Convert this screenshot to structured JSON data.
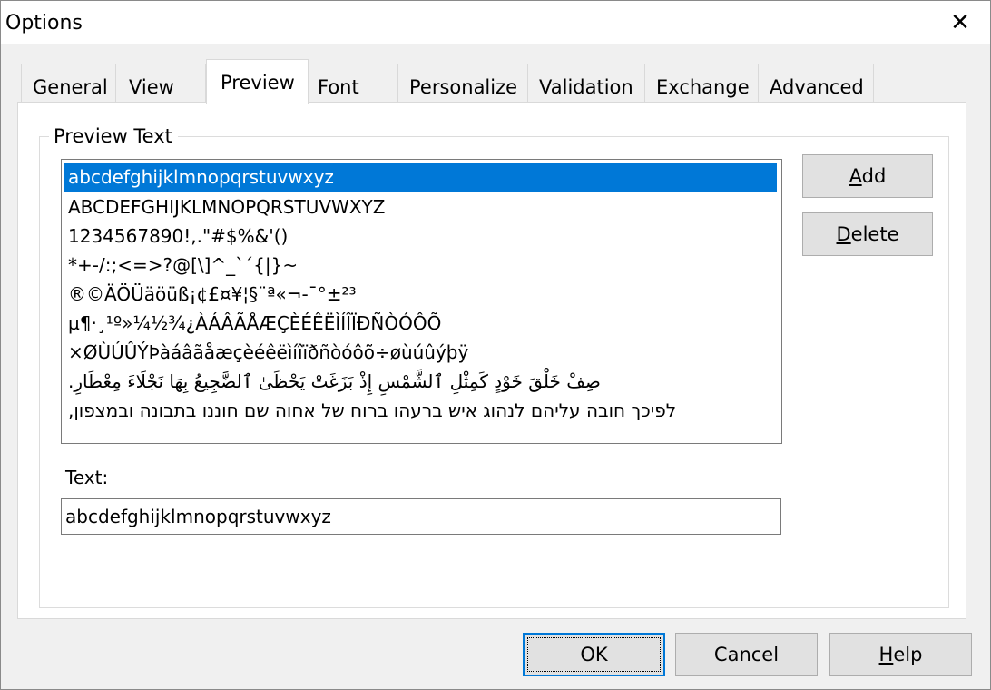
{
  "window": {
    "title": "Options",
    "close_glyph": "✕"
  },
  "tabs": [
    {
      "label": "General",
      "selected": false
    },
    {
      "label": "View",
      "selected": false
    },
    {
      "label": "Preview",
      "selected": true
    },
    {
      "label": "Font",
      "selected": false
    },
    {
      "label": "Personalize",
      "selected": false
    },
    {
      "label": "Validation",
      "selected": false
    },
    {
      "label": "Exchange",
      "selected": false
    },
    {
      "label": "Advanced",
      "selected": false
    }
  ],
  "preview": {
    "group_label": "Preview Text",
    "list_items": [
      "abcdefghijklmnopqrstuvwxyz",
      "ABCDEFGHIJKLMNOPQRSTUVWXYZ",
      "1234567890!,.\"#$%&'()",
      "*+-/:;<=>?@[\\]^_`´{|}~",
      "®©ÄÖÜäöüß¡¢£¤¥¦§¨ª«¬-¯°±²³",
      "µ¶·¸¹º»¼½¾¿ÀÁÂÃÅÆÇÈÉÊËÌÍÎÏÐÑÒÓÔÕ",
      "×ØÙÚÛÝÞàáâãåæçèéêëìíîïðñòóôõ÷øùúûýþÿ",
      "صِفْ خَلْقَ خَوْدٍ كَمِثْلِ ٱلشَّمْسِ إِذْ بَزَغَتْ يَحْظَىٰ ٱلضَّجِيعُ بِهَا نَجْلَاءَ مِعْطَارِ.",
      "לפיכך חובה עליהם לנהוג איש ברעהו ברוח של אחוה שם חוננו בתבונה ובמצפון,"
    ],
    "selected_index": 0,
    "add_button": {
      "label": "Add",
      "mnemonic": "A",
      "rest": "dd"
    },
    "delete_button": {
      "label": "Delete",
      "mnemonic": "D",
      "rest": "elete"
    },
    "text_label": "Text:",
    "text_value": "abcdefghijklmnopqrstuvwxyz"
  },
  "footer": {
    "ok": "OK",
    "cancel": "Cancel",
    "help": {
      "label": "Help",
      "mnemonic": "H",
      "rest": "elp"
    }
  },
  "colors": {
    "selection": "#0078d7",
    "button_face": "#e1e1e1",
    "dialog_bg": "#f0f0f0"
  }
}
